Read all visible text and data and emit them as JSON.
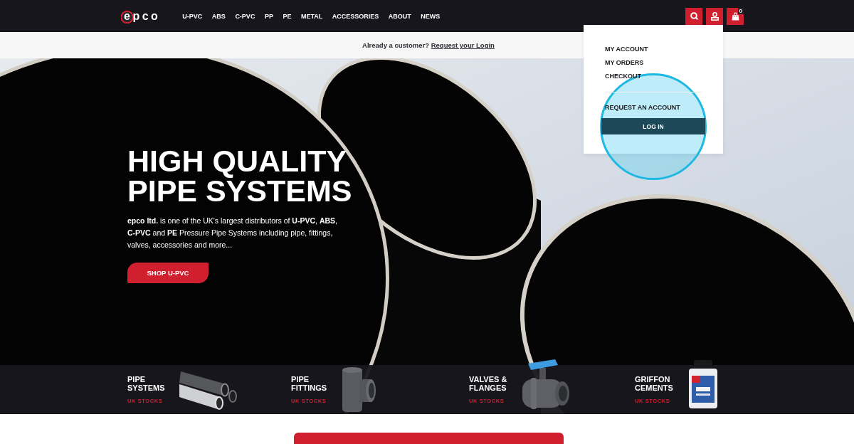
{
  "header": {
    "logo": "epco",
    "nav": [
      {
        "label": "U-PVC"
      },
      {
        "label": "ABS"
      },
      {
        "label": "C-PVC"
      },
      {
        "label": "PP"
      },
      {
        "label": "PE"
      },
      {
        "label": "METAL"
      },
      {
        "label": "ACCESSORIES"
      },
      {
        "label": "ABOUT"
      },
      {
        "label": "NEWS"
      }
    ],
    "actions": [
      {
        "kind": "search"
      },
      {
        "kind": "account"
      },
      {
        "kind": "cart",
        "badge": "0"
      }
    ]
  },
  "login_bar": {
    "prompt": "Already a customer?",
    "link": "Request your Login"
  },
  "account_menu": {
    "items": [
      {
        "label": "MY ACCOUNT"
      },
      {
        "label": "MY ORDERS"
      },
      {
        "label": "CHECKOUT"
      }
    ],
    "request_link": "REQUEST AN ACCOUNT",
    "login_button": "LOG IN"
  },
  "hero": {
    "title": "HIGH QUALITY PIPE SYSTEMS",
    "text": "**epco ltd.** is one of the UK's largest distributors of **U-PVC**, **ABS**, **C-PVC** and **PE** Pressure Pipe Systems including pipe, fittings, valves, accessories and more...",
    "button": "SHOP U-PVC"
  },
  "categories": [
    {
      "kind": "pipes",
      "title": "PIPE\nSYSTEMS",
      "tag": "UK STOCKS"
    },
    {
      "kind": "fitting",
      "title": "PIPE\nFITTINGS",
      "tag": "UK STOCKS"
    },
    {
      "kind": "valve",
      "title": "VALVES &\nFLANGES",
      "tag": "UK STOCKS"
    },
    {
      "kind": "tin",
      "title": "GRIFFON\nCEMENTS",
      "tag": "UK STOCKS"
    }
  ]
}
